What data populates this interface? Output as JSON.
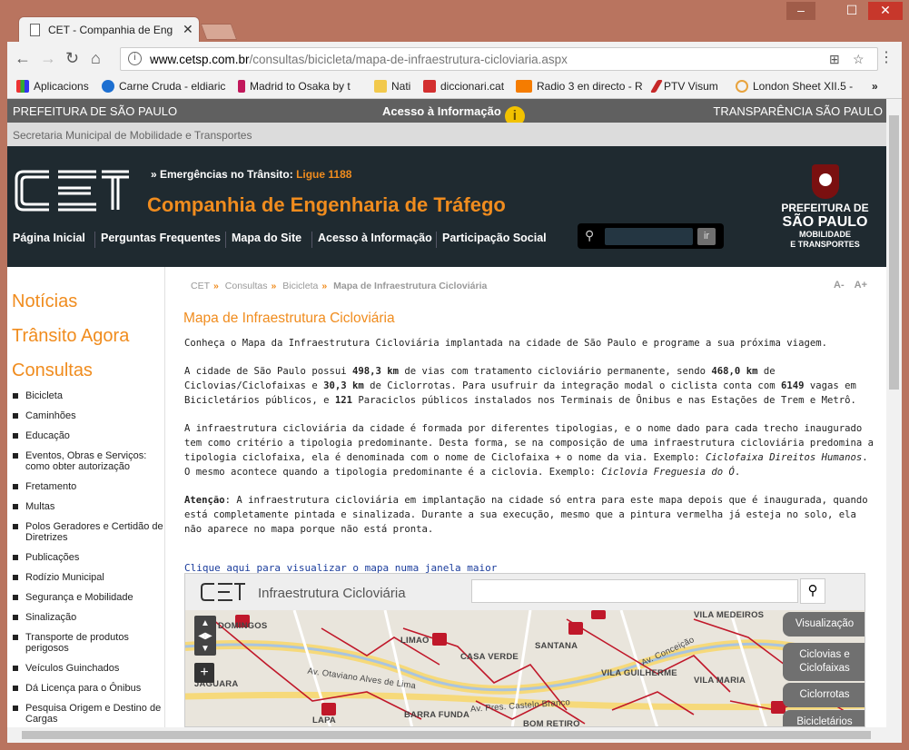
{
  "browser": {
    "tab_title": "CET - Companhia de Eng",
    "url_host": "www.cetsp.com.br",
    "url_path": "/consultas/bicicleta/mapa-de-infraestrutura-cicloviaria.aspx",
    "bookmarks": [
      "Aplicacions",
      "Carne Cruda - eldiaric",
      "Madrid to Osaka by t",
      "Nati",
      "diccionari.cat",
      "Radio 3 en directo - R",
      "PTV Visum",
      "London Sheet XII.5 -"
    ]
  },
  "topbar": {
    "left": "PREFEITURA DE SÃO PAULO",
    "center": "Acesso à Informação",
    "right": "TRANSPARÊNCIA SÃO PAULO",
    "secretaria": "Secretaria Municipal de Mobilidade e Transportes"
  },
  "header": {
    "emergencias_label": "» Emergências no Trânsito:",
    "emergencias_phone": "Ligue 1188",
    "company": "Companhia de Engenharia de Tráfego",
    "nav": [
      "Página Inicial",
      "Perguntas Frequentes",
      "Mapa do Site",
      "Acesso à Informação",
      "Participação Social"
    ],
    "search_button": "ir",
    "prefeitura_line1": "PREFEITURA DE",
    "prefeitura_line2": "SÃO PAULO",
    "prefeitura_line3": "MOBILIDADE",
    "prefeitura_line4": "E TRANSPORTES"
  },
  "sidebar": {
    "big": [
      "Notícias",
      "Trânsito Agora",
      "Consultas"
    ],
    "items": [
      "Bicicleta",
      "Caminhões",
      "Educação",
      "Eventos, Obras e Serviços: como obter autorização",
      "Fretamento",
      "Multas",
      "Polos Geradores e Certidão de Diretrizes",
      "Publicações",
      "Rodízio Municipal",
      "Segurança e Mobilidade",
      "Sinalização",
      "Transporte de produtos perigosos",
      "Veículos Guinchados",
      "Dá Licença para o Ônibus",
      "Pesquisa Origem e Destino de Cargas"
    ]
  },
  "breadcrumb": [
    "CET",
    "Consultas",
    "Bicicleta",
    "Mapa de Infraestrutura Cicloviária"
  ],
  "font_controls": {
    "minus": "A-",
    "plus": "A+"
  },
  "content": {
    "title": "Mapa de Infraestrutura Cicloviária",
    "p1": "Conheça o Mapa da Infraestrutura Cicloviária implantada na cidade de São Paulo e programe a sua próxima viagem.",
    "p2_a": "A cidade de São Paulo possui ",
    "p2_b": "498,3 km",
    "p2_c": " de vias com tratamento cicloviário permanente, sendo ",
    "p2_d": "468,0 km",
    "p2_e": " de Ciclovias/Ciclofaixas e ",
    "p2_f": "30,3 km",
    "p2_g": " de Ciclorrotas. Para usufruir da integração modal o ciclista conta com ",
    "p2_h": "6149",
    "p2_i": " vagas em Bicicletários públicos, e ",
    "p2_j": "121",
    "p2_k": " Paraciclos públicos instalados nos Terminais de Ônibus e nas Estações de Trem e Metrô.",
    "p3_a": "A infraestrutura cicloviária da cidade é formada por diferentes tipologias, e o nome dado para cada trecho inaugurado tem como critério a tipologia predominante. Desta forma, se na composição de uma infraestrutura cicloviária predomina a tipologia ciclofaixa, ela é denominada com o nome de Ciclofaixa + o nome da via. Exemplo: ",
    "p3_b": "Ciclofaixa Direitos Humanos",
    "p3_c": ". O mesmo acontece quando a tipologia predominante é a ciclovia. Exemplo: ",
    "p3_d": "Ciclovia Freguesia do Ó",
    "p3_e": ".",
    "p4_a": "Atenção",
    "p4_b": ": A infraestrutura cicloviária em implantação na cidade só entra para este mapa depois que é inaugurada, quando está completamente pintada e sinalizada. Durante a sua execução, mesmo que a pintura vermelha já esteja no solo, ela não aparece no mapa porque não está pronta.",
    "map_link": "Clique aqui para visualizar o mapa numa janela maior"
  },
  "map": {
    "title": "Infraestrutura Cicloviária",
    "labels": [
      "DOMINGOS",
      "LIMAO",
      "CASA VERDE",
      "SANTANA",
      "VILA GUILHERME",
      "VILA MARIA",
      "JAGUARA",
      "Av. Otaviano Alves de Lima",
      "Av. Pres. Castelo Branco",
      "BARRA FUNDA",
      "BOM RETIRO",
      "LAPA",
      "VILA MEDEIROS",
      "Av. Conceição"
    ],
    "buttons": [
      "Visualização",
      "Ciclovias e Ciclofaixas",
      "Ciclorrotas",
      "Bicicletários"
    ]
  }
}
